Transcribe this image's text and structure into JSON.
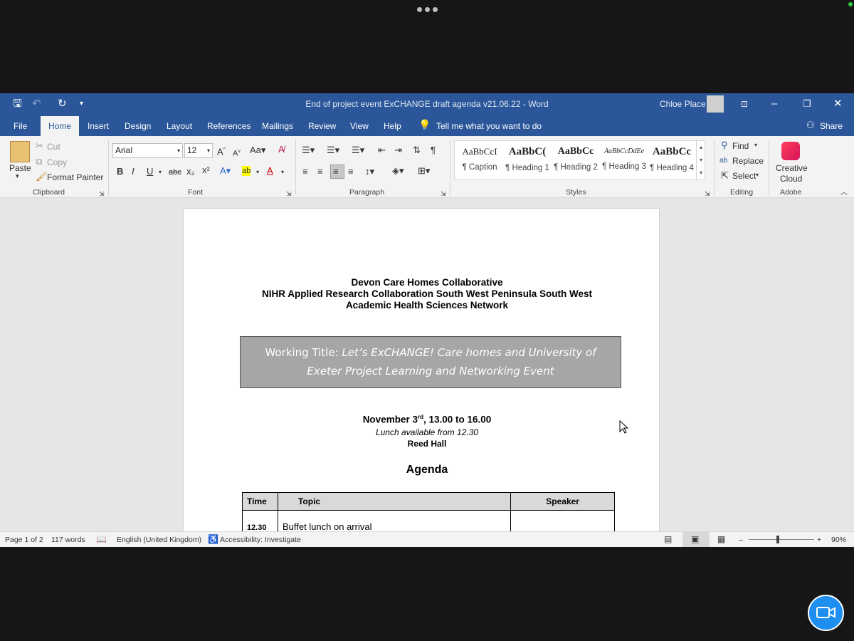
{
  "window": {
    "title": "End of project event ExCHANGE draft agenda v21.06.22  -  Word",
    "user_name": "Chloe Place"
  },
  "tabs": [
    "File",
    "Home",
    "Insert",
    "Design",
    "Layout",
    "References",
    "Mailings",
    "Review",
    "View",
    "Help"
  ],
  "tell_me": "Tell me what you want to do",
  "share": "Share",
  "clipboard": {
    "paste": "Paste",
    "cut": "Cut",
    "copy": "Copy",
    "format_painter": "Format Painter",
    "group": "Clipboard"
  },
  "font": {
    "name": "Arial",
    "size": "12",
    "group": "Font"
  },
  "paragraph": {
    "group": "Paragraph"
  },
  "styles": {
    "items": [
      {
        "sample": "AaBbCcI",
        "name": "¶ Caption"
      },
      {
        "sample": "AaBbC(",
        "name": "¶ Heading 1"
      },
      {
        "sample": "AaBbCc",
        "name": "¶ Heading 2"
      },
      {
        "sample": "AaBbCcDdEe",
        "name": "¶ Heading 3"
      },
      {
        "sample": "AaBbCc",
        "name": "¶ Heading 4"
      }
    ],
    "group": "Styles"
  },
  "editing": {
    "find": "Find",
    "replace": "Replace",
    "select": "Select",
    "group": "Editing"
  },
  "adobe": {
    "label1": "Creative",
    "label2": "Cloud",
    "group": "Adobe"
  },
  "document": {
    "header_line1": "Devon Care Homes Collaborative",
    "header_line2": "NIHR Applied Research Collaboration South West Peninsula South West",
    "header_line3": "Academic Health Sciences Network",
    "banner_prefix": "Working Title: ",
    "banner_italic1": "Let’s ExCHANGE! Care homes and University of",
    "banner_italic2": "Exeter Project Learning and Networking Event",
    "date_main": "November 3",
    "date_sup": "rd",
    "date_rest": ", 13.00 to 16.00",
    "lunch": "Lunch available from 12.30",
    "venue": "Reed Hall",
    "agenda_title": "Agenda",
    "table_headers": [
      "Time",
      "Topic",
      "Speaker"
    ],
    "rows": [
      {
        "time": "12.30",
        "topic": "Buffet lunch on arrival",
        "speaker": ""
      }
    ]
  },
  "status": {
    "page": "Page 1 of 2",
    "words": "117 words",
    "language": "English (United Kingdom)",
    "accessibility": "Accessibility: Investigate",
    "zoom": "90%"
  },
  "colors": {
    "ribbon_blue": "#2b579a",
    "banner_gray": "#a6a6a6",
    "video_button": "#1e8ef0"
  }
}
